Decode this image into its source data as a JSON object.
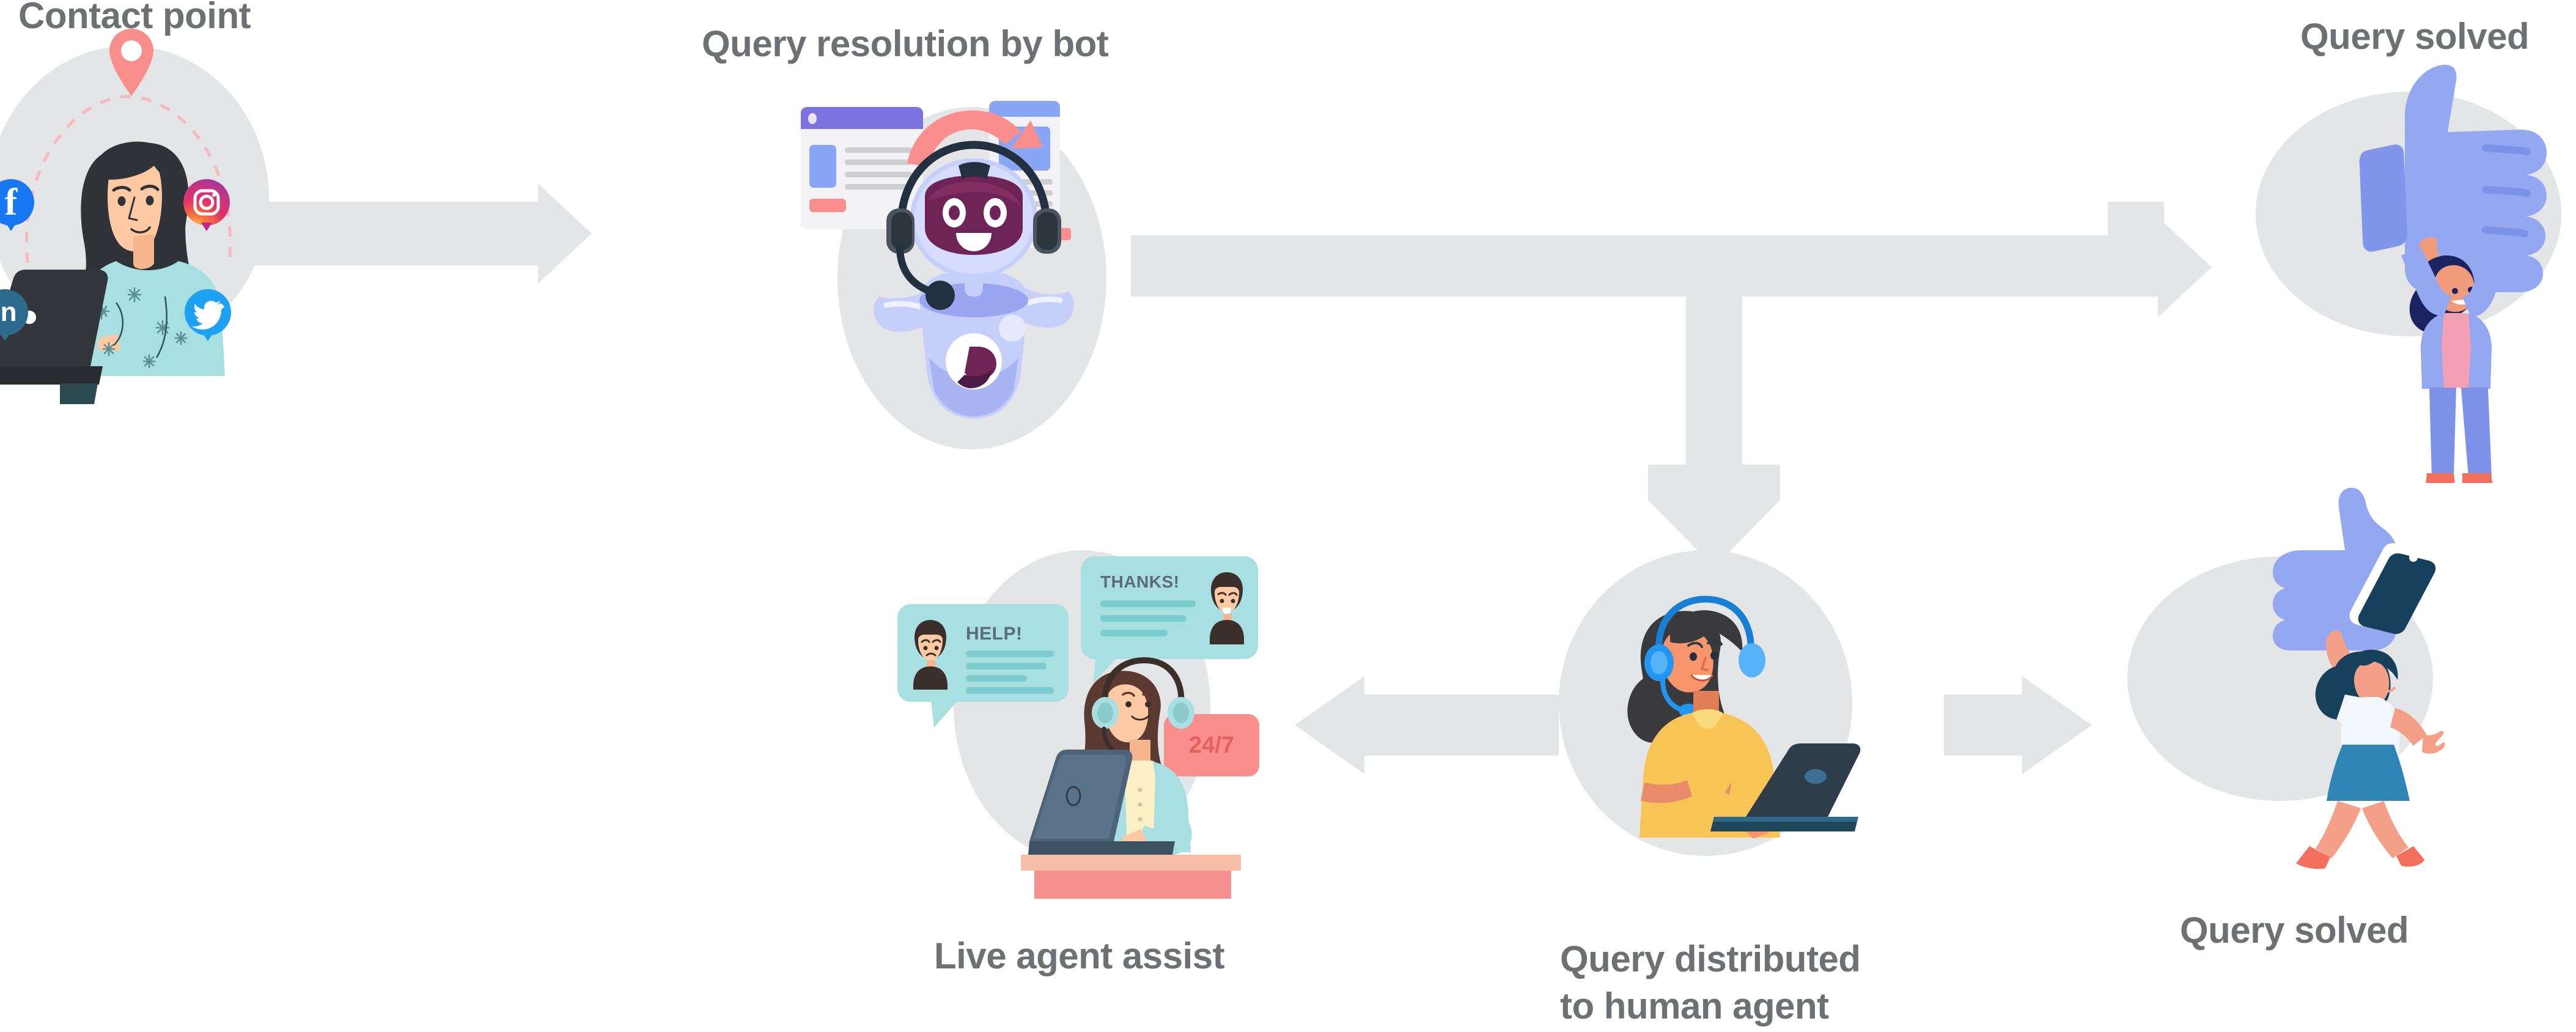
{
  "diagram": {
    "title_color": "#6e7074",
    "connector_color": "#e4e5e6",
    "background": "#ffffff"
  },
  "labels": {
    "contact_point": "Contact point",
    "query_resolution_by_bot": "Query resolution by bot",
    "query_solved_top": "Query solved",
    "live_agent_assist": "Live agent assist",
    "query_distributed_line1": "Query distributed",
    "query_distributed_line2": "to human agent",
    "query_solved_bottom": "Query solved"
  },
  "social_icons": [
    {
      "name": "facebook",
      "glyph": "f",
      "color": "#1877F2"
    },
    {
      "name": "instagram",
      "glyph": "◎",
      "color": "#E1306C"
    },
    {
      "name": "linkedin",
      "glyph": "in",
      "color": "#2D6A8E"
    },
    {
      "name": "twitter",
      "glyph": "ᴠ",
      "color": "#1DA1F2"
    }
  ],
  "chat": {
    "help_label": "HELP!",
    "thanks_label": "THANKS!",
    "availability_badge": "24/7"
  },
  "flow": {
    "steps": [
      "Contact point",
      "Query resolution by bot",
      "Query solved",
      "Query distributed to human agent",
      "Live agent assist",
      "Query solved"
    ]
  },
  "palette": {
    "gray_blob": "#e4e5e6",
    "coral": "#f98e8c",
    "periwinkle": "#8da4f5",
    "teal": "#a8dfe0",
    "navy": "#1e3557",
    "yellow": "#f7c455",
    "skin": "#ffc9a3"
  }
}
